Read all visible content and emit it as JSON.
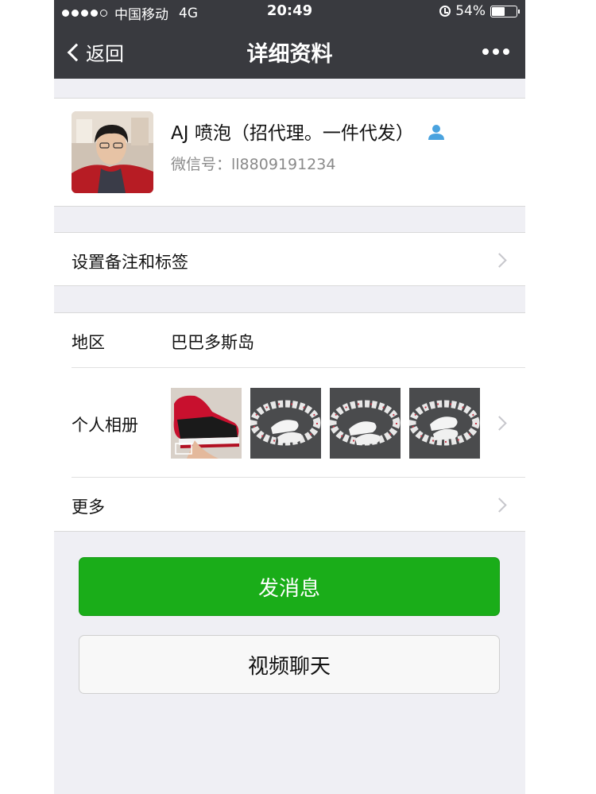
{
  "status_bar": {
    "carrier": "中国移动",
    "network": "4G",
    "time": "20:49",
    "battery_percent": "54%",
    "battery_level": 0.54,
    "signal_bars_filled": 4,
    "signal_bars_total": 5
  },
  "nav": {
    "back_label": "返回",
    "title": "详细资料"
  },
  "profile": {
    "nickname": "AJ 喷泡（招代理。一件代发）",
    "wechat_id": "微信号：ll8809191234"
  },
  "remark_row": {
    "label": "设置备注和标签"
  },
  "region_row": {
    "label": "地区",
    "value": "巴巴多斯岛"
  },
  "album_row": {
    "label": "个人相册",
    "photos": [
      "red-black-sneaker-photo",
      "white-sneakers-circle-photo",
      "white-sneakers-circle-photo",
      "white-sneakers-circle-photo"
    ]
  },
  "more_row": {
    "label": "更多"
  },
  "actions": {
    "send_message": "发消息",
    "video_call": "视频聊天"
  },
  "colors": {
    "nav_bg": "#393a3f",
    "page_bg": "#efeff4",
    "primary_green": "#1aad19",
    "contact_icon_blue": "#4aa3df"
  }
}
